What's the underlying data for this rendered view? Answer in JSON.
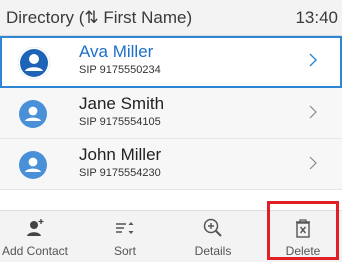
{
  "header": {
    "title": "Directory (⇅ First Name)",
    "time": "13:40"
  },
  "contacts": [
    {
      "name": "Ava Miller",
      "number": "SIP 9175550234",
      "selected": true
    },
    {
      "name": "Jane Smith",
      "number": "SIP 9175554105",
      "selected": false
    },
    {
      "name": "John Miller",
      "number": "SIP 9175554230",
      "selected": false
    }
  ],
  "softkeys": [
    {
      "label": "Add Contact",
      "icon": "add-contact-icon"
    },
    {
      "label": "Sort",
      "icon": "sort-icon"
    },
    {
      "label": "Details",
      "icon": "details-zoom-icon"
    },
    {
      "label": "Delete",
      "icon": "delete-trash-icon"
    }
  ],
  "colors": {
    "accent": "#2f86d4",
    "selected_name": "#1d6fc9",
    "avatar": "#4a90d9",
    "highlight": "#e01f26"
  }
}
